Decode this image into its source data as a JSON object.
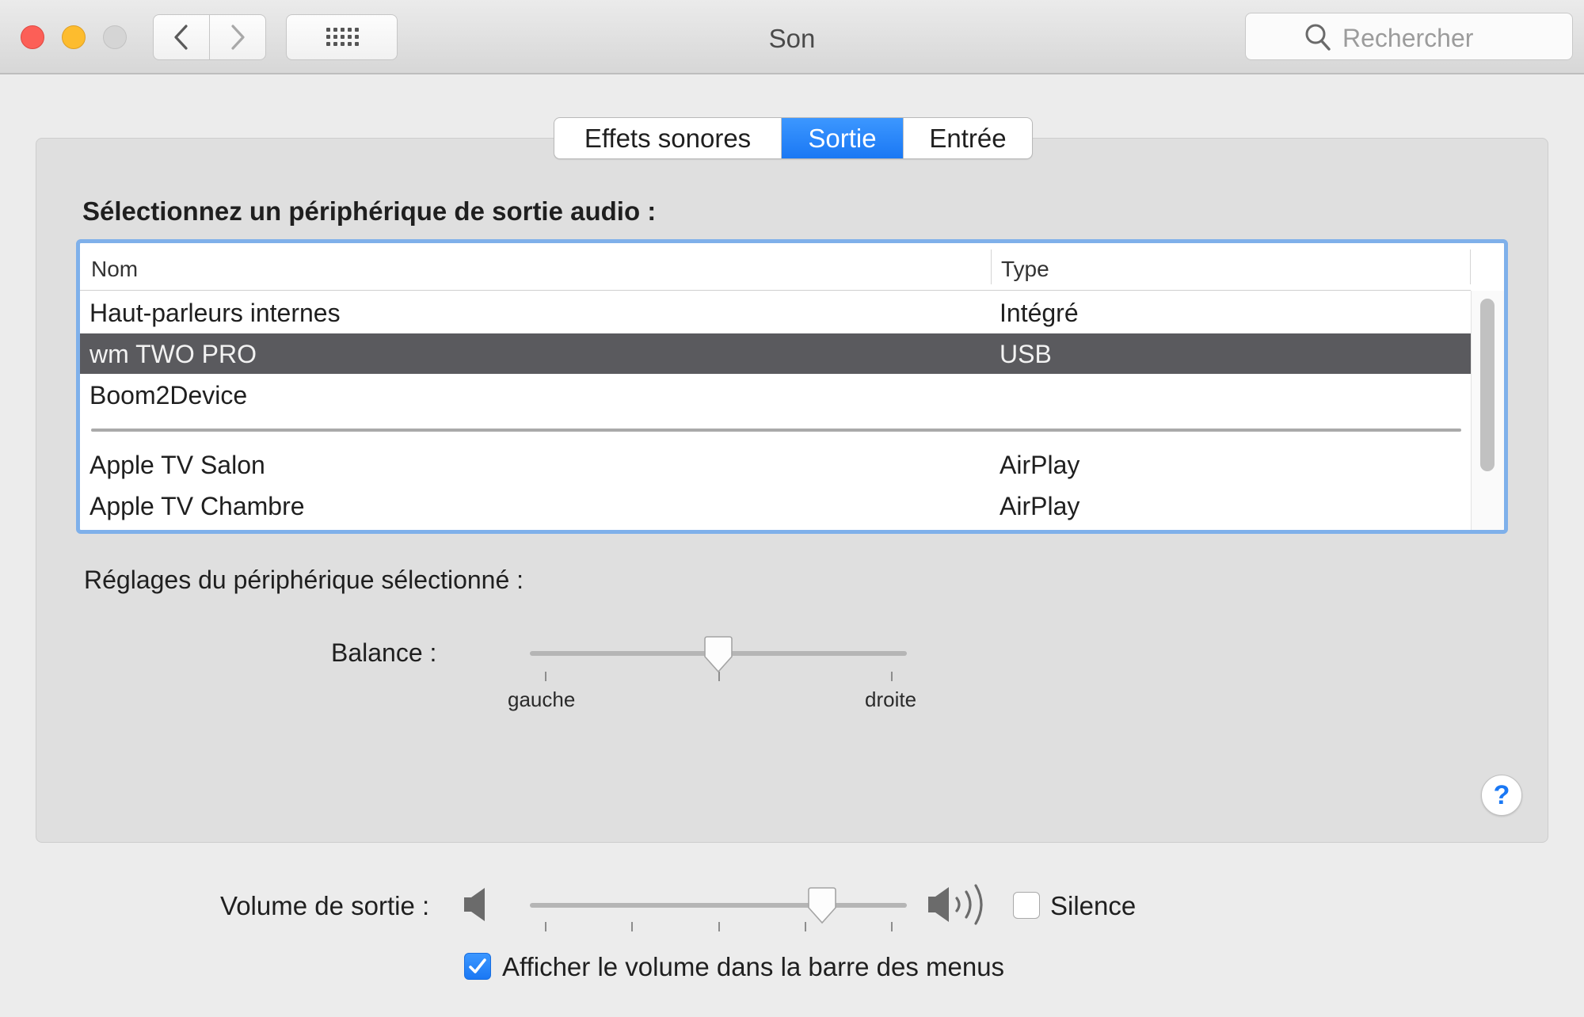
{
  "window": {
    "title": "Son"
  },
  "search": {
    "placeholder": "Rechercher"
  },
  "tabs": [
    {
      "label": "Effets sonores",
      "active": false
    },
    {
      "label": "Sortie",
      "active": true
    },
    {
      "label": "Entrée",
      "active": false
    }
  ],
  "output": {
    "select_label": "Sélectionnez un périphérique de sortie audio :",
    "columns": {
      "name": "Nom",
      "type": "Type"
    },
    "devices": [
      {
        "name": "Haut-parleurs internes",
        "type": "Intégré",
        "selected": false
      },
      {
        "name": "wm TWO PRO",
        "type": "USB",
        "selected": true
      },
      {
        "name": "Boom2Device",
        "type": "",
        "selected": false
      },
      {
        "name": "Apple TV Salon",
        "type": "AirPlay",
        "selected": false
      },
      {
        "name": "Apple TV Chambre",
        "type": "AirPlay",
        "selected": false
      }
    ],
    "settings_label": "Réglages du périphérique sélectionné :",
    "balance": {
      "label": "Balance :",
      "left_label": "gauche",
      "right_label": "droite",
      "value_percent": 50
    }
  },
  "volume": {
    "label": "Volume de sortie :",
    "value_percent": 80,
    "mute_label": "Silence",
    "mute_checked": false,
    "menubar_label": "Afficher le volume dans la barre des menus",
    "menubar_checked": true
  },
  "help": {
    "symbol": "?"
  },
  "colors": {
    "accent": "#1a78f4",
    "selection": "#5a5a5e",
    "focus_ring": "#7fb0ea"
  }
}
